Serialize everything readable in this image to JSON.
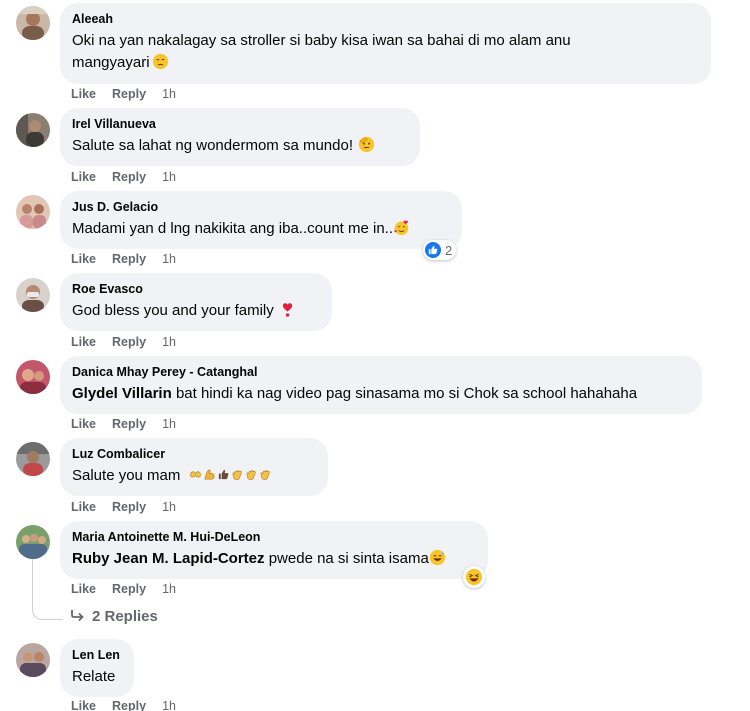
{
  "colors": {
    "bubble_bg": "#f0f2f5",
    "meta_text": "#65676b",
    "like_blue": "#1877f2",
    "heart_red": "#e41e3f"
  },
  "comments": [
    {
      "author": "Aleeah",
      "text_line1": "Oki na yan nakalagay sa stroller si baby kisa iwan sa bahai di mo alam anu",
      "text_line2": "mangyayari",
      "emoji": "sad-face-emoji",
      "like": "Like",
      "reply": "Reply",
      "time": "1h"
    },
    {
      "author": "Irel Villanueva",
      "text": "Salute sa lahat ng wondermom sa mundo!",
      "emoji": "saluting-face-emoji",
      "like": "Like",
      "reply": "Reply",
      "time": "1h"
    },
    {
      "author": "Jus D. Gelacio",
      "text": "Madami yan d lng nakikita ang iba..count me in..",
      "emoji": "smiling-face-with-hearts-emoji",
      "reaction_count": "2",
      "reaction_icon": "like-reaction-icon",
      "like": "Like",
      "reply": "Reply",
      "time": "1h"
    },
    {
      "author": "Roe Evasco",
      "text": "God bless you and your family",
      "emoji": "heart-exclamation-emoji",
      "like": "Like",
      "reply": "Reply",
      "time": "1h"
    },
    {
      "author": "Danica Mhay Perey - Catanghal",
      "tag": "Glydel Villarin",
      "text": "bat hindi ka nag video pag sinasama mo si Chok sa school hahahaha",
      "like": "Like",
      "reply": "Reply",
      "time": "1h"
    },
    {
      "author": "Luz Combalicer",
      "text": "Salute you mam",
      "emojis": [
        "heart-hands-emoji",
        "flexed-biceps-emoji",
        "thumbs-up-emoji",
        "clapping-hands-emoji",
        "clapping-hands-emoji",
        "clapping-hands-emoji"
      ],
      "like": "Like",
      "reply": "Reply",
      "time": "1h"
    },
    {
      "author": "Maria Antoinette M. Hui-DeLeon",
      "tag": "Ruby Jean M. Lapid-Cortez",
      "text": "pwede na si sinta isama",
      "emoji": "grinning-sweat-emoji",
      "reaction_icon": "haha-reaction-icon",
      "like": "Like",
      "reply": "Reply",
      "time": "1h",
      "replies_label": "2 Replies"
    },
    {
      "author": "Len Len",
      "text": "Relate",
      "like": "Like",
      "reply": "Reply",
      "time": "1h"
    }
  ]
}
